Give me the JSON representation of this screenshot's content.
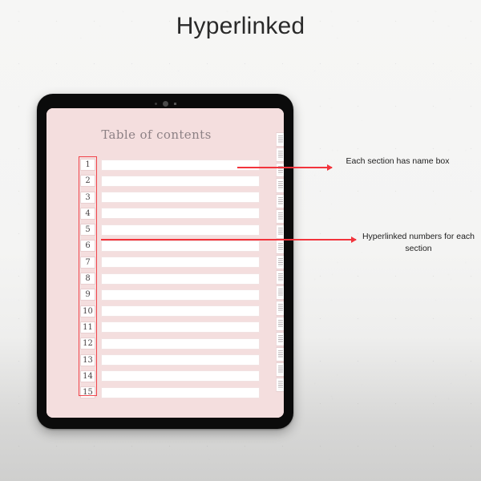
{
  "page": {
    "title": "Hyperlinked",
    "background_color": "#f4f4f3"
  },
  "device": {
    "name": "tablet-mockup",
    "bezel_color": "#0b0b0b",
    "screen_background": "#f4dede",
    "sensors": [
      "sensor-dot-small",
      "sensor-dot-large",
      "sensor-dot-square"
    ]
  },
  "planner": {
    "heading": "Table of contents",
    "accent_color": "#f2343c",
    "name_box_color": "#ffffff",
    "rows": [
      {
        "number": "1",
        "name": ""
      },
      {
        "number": "2",
        "name": ""
      },
      {
        "number": "3",
        "name": ""
      },
      {
        "number": "4",
        "name": ""
      },
      {
        "number": "5",
        "name": ""
      },
      {
        "number": "6",
        "name": ""
      },
      {
        "number": "7",
        "name": ""
      },
      {
        "number": "8",
        "name": ""
      },
      {
        "number": "9",
        "name": ""
      },
      {
        "number": "10",
        "name": ""
      },
      {
        "number": "11",
        "name": ""
      },
      {
        "number": "12",
        "name": ""
      },
      {
        "number": "13",
        "name": ""
      },
      {
        "number": "14",
        "name": ""
      },
      {
        "number": "15",
        "name": ""
      }
    ],
    "side_tabs_count": 17
  },
  "annotations": [
    {
      "text": "Each section has name box",
      "arrow": "points-right-to-name-box"
    },
    {
      "text": "Hyperlinked numbers for each section",
      "arrow": "points-right-from-number-column"
    }
  ]
}
